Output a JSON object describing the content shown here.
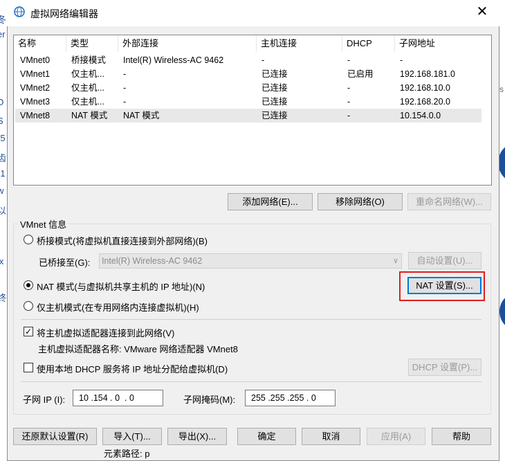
{
  "window": {
    "title": "虚拟网络编辑器",
    "close_glyph": "✕"
  },
  "bg_left_fragments": [
    "t",
    "冬",
    "er",
    "D",
    "S",
    "(5",
    "齿",
    "(1",
    "w",
    "以",
    "ix",
    "(",
    "终"
  ],
  "bg_right_fragment": "ks",
  "bottom_cut_text": "元素路径: p",
  "table": {
    "columns": [
      "名称",
      "类型",
      "外部连接",
      "主机连接",
      "DHCP",
      "子网地址"
    ],
    "rows": [
      [
        "VMnet0",
        "桥接模式",
        "Intel(R) Wireless-AC 9462",
        "-",
        "-",
        "-"
      ],
      [
        "VMnet1",
        "仅主机...",
        "-",
        "已连接",
        "已启用",
        "192.168.181.0"
      ],
      [
        "VMnet2",
        "仅主机...",
        "-",
        "已连接",
        "-",
        "192.168.10.0"
      ],
      [
        "VMnet3",
        "仅主机...",
        "-",
        "已连接",
        "-",
        "192.168.20.0"
      ],
      [
        "VMnet8",
        "NAT 模式",
        "NAT 模式",
        "已连接",
        "-",
        "10.154.0.0"
      ]
    ],
    "selected_row": 4
  },
  "list_buttons": {
    "add": "添加网络(E)...",
    "remove": "移除网络(O)",
    "rename": "重命名网络(W)..."
  },
  "vmnet_info": {
    "group_label": "VMnet 信息",
    "bridge_radio": "桥接模式(将虚拟机直接连接到外部网络)(B)",
    "bridged_to_label": "已桥接至(G):",
    "bridged_to_value": "Intel(R) Wireless-AC 9462",
    "auto_settings": "自动设置(U)...",
    "nat_radio": "NAT 模式(与虚拟机共享主机的 IP 地址)(N)",
    "nat_settings": "NAT 设置(S)...",
    "hostonly_radio": "仅主机模式(在专用网络内连接虚拟机)(H)",
    "connect_adapter": "将主机虚拟适配器连接到此网络(V)",
    "adapter_name": "主机虚拟适配器名称: VMware 网络适配器 VMnet8",
    "use_dhcp": "使用本地 DHCP 服务将 IP 地址分配给虚拟机(D)",
    "dhcp_settings": "DHCP 设置(P)...",
    "subnet_ip_label": "子网 IP (I):",
    "subnet_ip_value": "10 .154 . 0  . 0",
    "subnet_mask_label": "子网掩码(M):",
    "subnet_mask_value": "255 .255 .255 . 0",
    "selected_mode": "nat",
    "connect_adapter_checked": true,
    "use_dhcp_checked": false
  },
  "footer_buttons": {
    "restore": "还原默认设置(R)",
    "import": "导入(T)...",
    "export": "导出(X)...",
    "ok": "确定",
    "cancel": "取消",
    "apply": "应用(A)",
    "help": "帮助"
  },
  "colors": {
    "accent": "#0078d7",
    "highlight_box": "#e01e1e",
    "dialog_bg": "#f0f0f0"
  }
}
